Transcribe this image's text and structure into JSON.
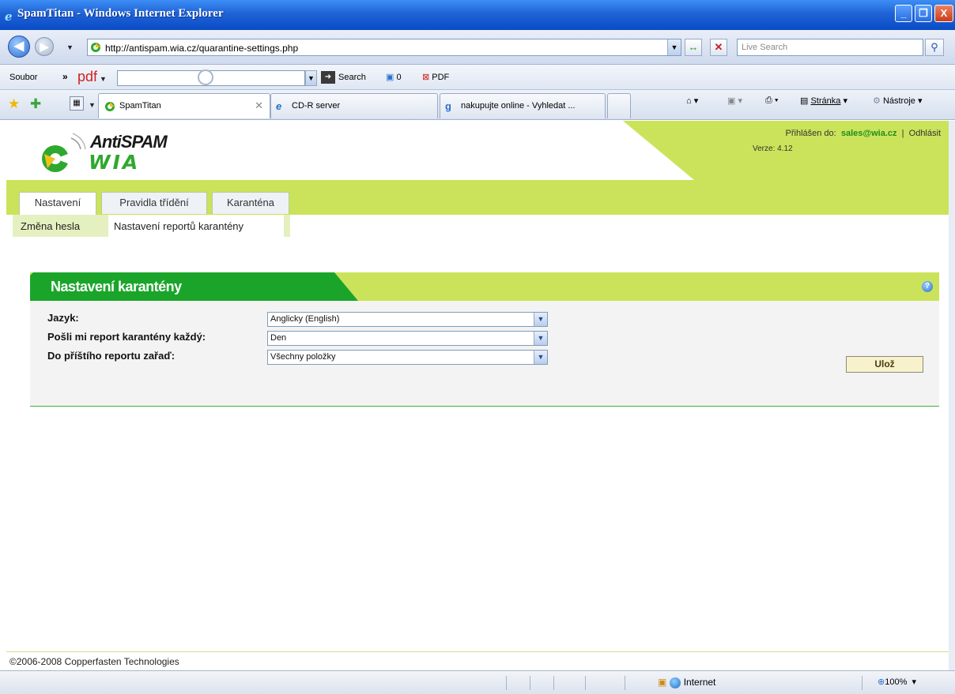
{
  "window": {
    "title": "SpamTitan - Windows Internet Explorer",
    "minimize": "_",
    "maximize": "❐",
    "close": "X"
  },
  "address": {
    "url": "http://antispam.wia.cz/quarantine-settings.php",
    "search_placeholder": "Live Search"
  },
  "toolbar": {
    "menu": "Soubor",
    "chevron": "»",
    "pdf_logo": "pdf",
    "search_label": "Search",
    "counter": "0",
    "pdf_label": "PDF"
  },
  "tabs": [
    {
      "label": "SpamTitan",
      "active": true
    },
    {
      "label": "CD-R server",
      "active": false
    },
    {
      "label": "nakupujte online - Vyhledat ...",
      "active": false
    }
  ],
  "commands": {
    "page": "Stránka",
    "tools": "Nástroje"
  },
  "header": {
    "logo_anti": "Anti",
    "logo_spam": "SPAM",
    "logo_wia": "WIA",
    "login_label": "Přihlášen do:",
    "user": "sales@wia.cz",
    "separator": "|",
    "logout": "Odhlásit",
    "version": "Verze: 4.12"
  },
  "nav": {
    "main_tabs": [
      {
        "label": "Nastavení",
        "active": true
      },
      {
        "label": "Pravidla třídění",
        "active": false
      },
      {
        "label": "Karanténa",
        "active": false
      }
    ],
    "sub_items": [
      {
        "label": "Změna hesla",
        "active": false
      },
      {
        "label": "Nastavení reportů karantény",
        "active": true
      }
    ]
  },
  "panel": {
    "title": "Nastavení karantény",
    "help": "?",
    "fields": [
      {
        "label": "Jazyk:",
        "value": "Anglicky (English)"
      },
      {
        "label": "Pošli mi report karantény každý:",
        "value": "Den"
      },
      {
        "label": "Do příštího reportu zařaď:",
        "value": "Všechny položky"
      }
    ],
    "save_label": "Ulož"
  },
  "footer": {
    "copyright": "©2006-2008 Copperfasten Technologies"
  },
  "status": {
    "zone": "Internet",
    "zoom": "100%"
  },
  "colors": {
    "brand_green": "#2fa82f",
    "lime": "#cbe35a",
    "panel_green": "#1aa52a"
  }
}
